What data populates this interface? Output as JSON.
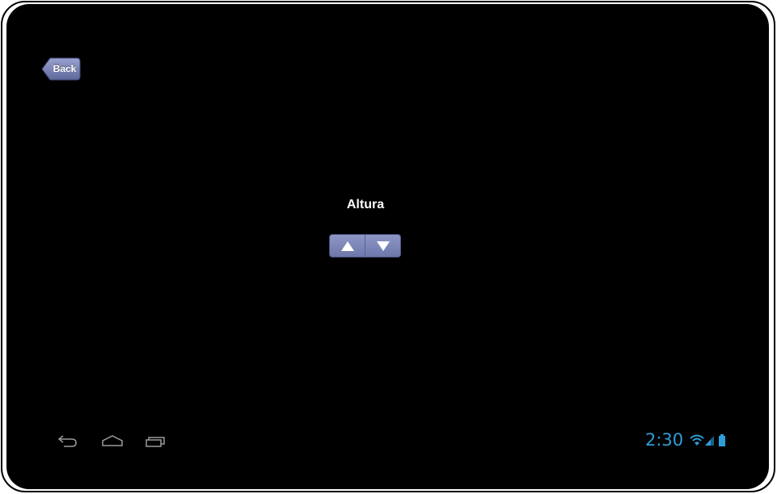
{
  "back_button": {
    "label": "Back"
  },
  "page_title": "Altura",
  "stepper": {
    "up_icon": "triangle-up",
    "down_icon": "triangle-down"
  },
  "system_bar": {
    "time": "2:30",
    "nav_icons": [
      "back-arrow-icon",
      "home-icon",
      "recent-apps-icon"
    ],
    "status_icons": [
      "wifi-icon",
      "signal-icon",
      "battery-icon"
    ],
    "accent_color": "#2f9ed8"
  },
  "colors": {
    "screen_background": "#000000",
    "button_color": "#7880b4",
    "text_color": "#ffffff"
  }
}
